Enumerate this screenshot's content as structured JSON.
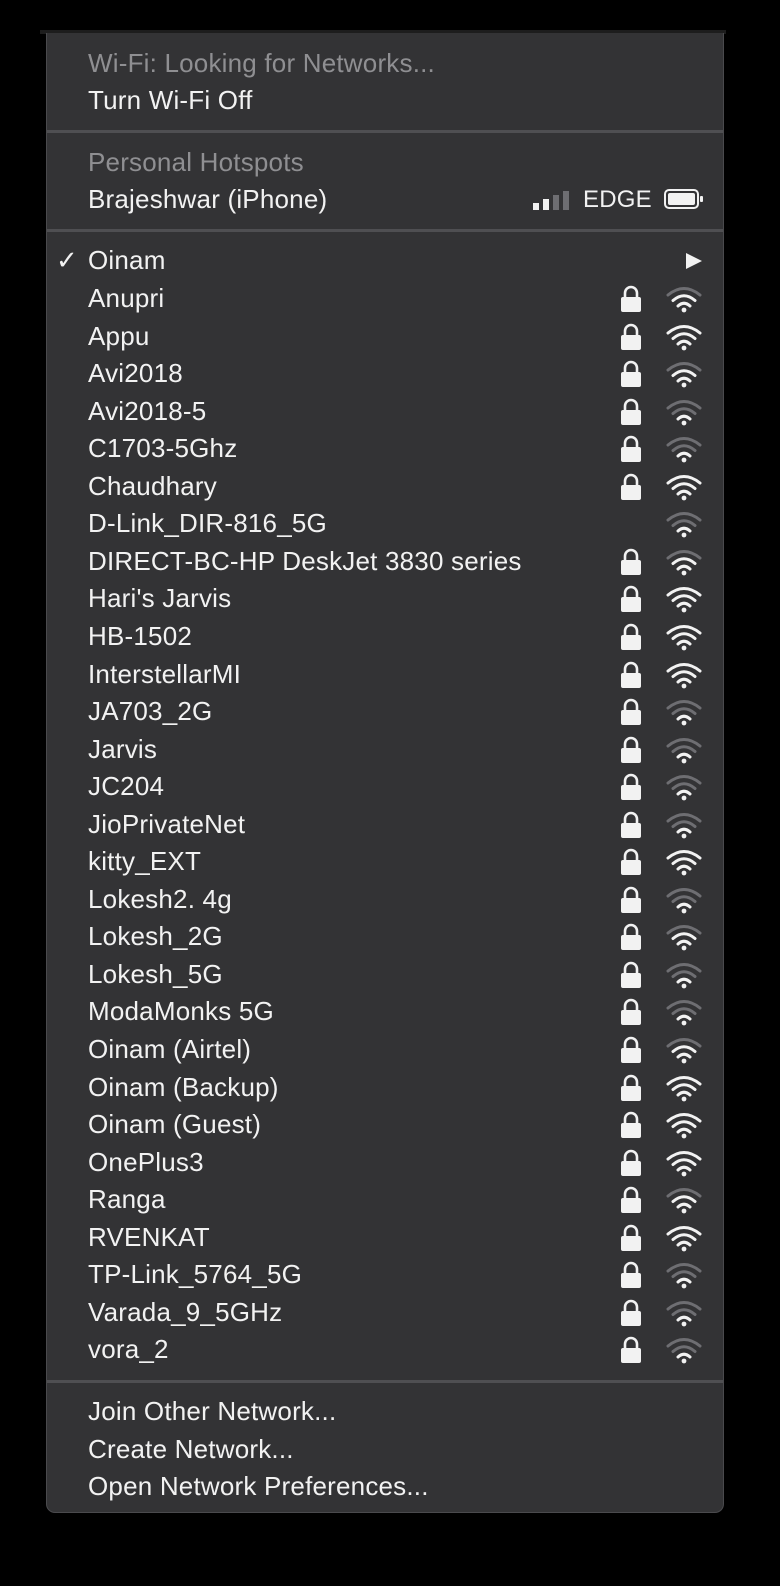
{
  "wifi": {
    "status": "Wi-Fi: Looking for Networks...",
    "toggle": "Turn Wi-Fi Off"
  },
  "hotspots": {
    "header": "Personal Hotspots",
    "device": "Brajeshwar (iPhone)",
    "network_type": "EDGE",
    "signal_bars": 2,
    "signal_bars_total": 4
  },
  "connected": {
    "name": "Oinam",
    "checkmark": "✓"
  },
  "networks": [
    {
      "name": "Anupri",
      "locked": true,
      "strength": 2
    },
    {
      "name": "Appu",
      "locked": true,
      "strength": 3
    },
    {
      "name": "Avi2018",
      "locked": true,
      "strength": 2
    },
    {
      "name": "Avi2018-5",
      "locked": true,
      "strength": 1
    },
    {
      "name": "C1703-5Ghz",
      "locked": true,
      "strength": 1
    },
    {
      "name": "Chaudhary",
      "locked": true,
      "strength": 3
    },
    {
      "name": "D-Link_DIR-816_5G",
      "locked": false,
      "strength": 1
    },
    {
      "name": "DIRECT-BC-HP DeskJet 3830 series",
      "locked": true,
      "strength": 2
    },
    {
      "name": "Hari's Jarvis",
      "locked": true,
      "strength": 3
    },
    {
      "name": "HB-1502",
      "locked": true,
      "strength": 3
    },
    {
      "name": "InterstellarMI",
      "locked": true,
      "strength": 3
    },
    {
      "name": "JA703_2G",
      "locked": true,
      "strength": 1
    },
    {
      "name": "Jarvis",
      "locked": true,
      "strength": 1
    },
    {
      "name": "JC204",
      "locked": true,
      "strength": 1
    },
    {
      "name": "JioPrivateNet",
      "locked": true,
      "strength": 1
    },
    {
      "name": "kitty_EXT",
      "locked": true,
      "strength": 3
    },
    {
      "name": "Lokesh2. 4g",
      "locked": true,
      "strength": 1
    },
    {
      "name": "Lokesh_2G",
      "locked": true,
      "strength": 2
    },
    {
      "name": "Lokesh_5G",
      "locked": true,
      "strength": 1
    },
    {
      "name": "ModaMonks 5G",
      "locked": true,
      "strength": 1
    },
    {
      "name": "Oinam (Airtel)",
      "locked": true,
      "strength": 2
    },
    {
      "name": "Oinam (Backup)",
      "locked": true,
      "strength": 3
    },
    {
      "name": "Oinam (Guest)",
      "locked": true,
      "strength": 3
    },
    {
      "name": "OnePlus3",
      "locked": true,
      "strength": 3
    },
    {
      "name": "Ranga",
      "locked": true,
      "strength": 2
    },
    {
      "name": "RVENKAT",
      "locked": true,
      "strength": 3
    },
    {
      "name": "TP-Link_5764_5G",
      "locked": true,
      "strength": 1
    },
    {
      "name": "Varada_9_5GHz",
      "locked": true,
      "strength": 1
    },
    {
      "name": "vora_2",
      "locked": true,
      "strength": 1
    }
  ],
  "actions": {
    "join_other": "Join Other Network...",
    "create": "Create Network...",
    "preferences": "Open Network Preferences..."
  },
  "colors": {
    "menu_bg": "#333335",
    "text": "#f2f2f2",
    "header_text": "#8f8f92",
    "separator": "#4f4f52",
    "wifi_active": "#f2f2f2",
    "wifi_inactive": "#6e6e72"
  }
}
